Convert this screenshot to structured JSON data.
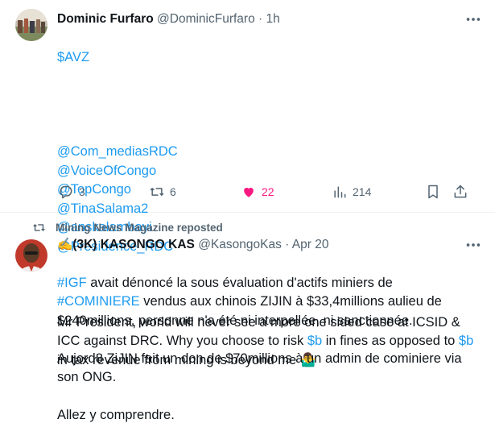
{
  "tweet1": {
    "author_name": "Dominic Furfaro",
    "handle": "@DominicFurfaro",
    "separator": "·",
    "time": "1h",
    "cashtag": "$AVZ",
    "mentions": [
      "@Com_mediasRDC",
      "@VoiceOfCongo",
      "@TopCongo",
      "@TinaSalama2",
      "@anskalambayi",
      "@Presidence_RDC"
    ],
    "text_part1": "Mr President, world will never see a more one sided case at ICSID & ICC against DRC. Why you choose to risk ",
    "cashtag_b1": "$b",
    "text_part2": " in fines as opposed to ",
    "cashtag_b2": "$b",
    "text_part3": " in tax revenue from mining is beyond me ",
    "emoji": "🤷‍♂️",
    "stats": {
      "replies": "3",
      "reposts": "6",
      "likes": "22",
      "views": "214"
    },
    "liked": true
  },
  "tweet2": {
    "repost_label": "Mining News Magazine reposted",
    "author_name": "✍️(3K) KASONGO KAS",
    "handle": "@KasongoKas",
    "separator": "·",
    "time": "Apr 20",
    "hashtag1": "#IGF",
    "text_a": " avait dénoncé la sous évaluation d'actifs miniers de",
    "hashtag2": "#COMINIERE",
    "text_b": " vendus aux chinois ZIJIN à $33,4millions aulieu de $240millions, personne n'a été ni interpellée, ni sanctionnée.",
    "text_c": "Aujord8 ZiJIN fait un don de $70millions à un admin de cominiere via son ONG.",
    "text_d": "Allez y comprendre."
  },
  "colors": {
    "link": "#1d9bf0",
    "muted": "#536471",
    "like": "#f91880",
    "text": "#0f1419"
  },
  "icons": [
    "more-icon",
    "reply-icon",
    "repost-icon",
    "like-icon",
    "views-icon",
    "bookmark-icon",
    "share-icon"
  ]
}
